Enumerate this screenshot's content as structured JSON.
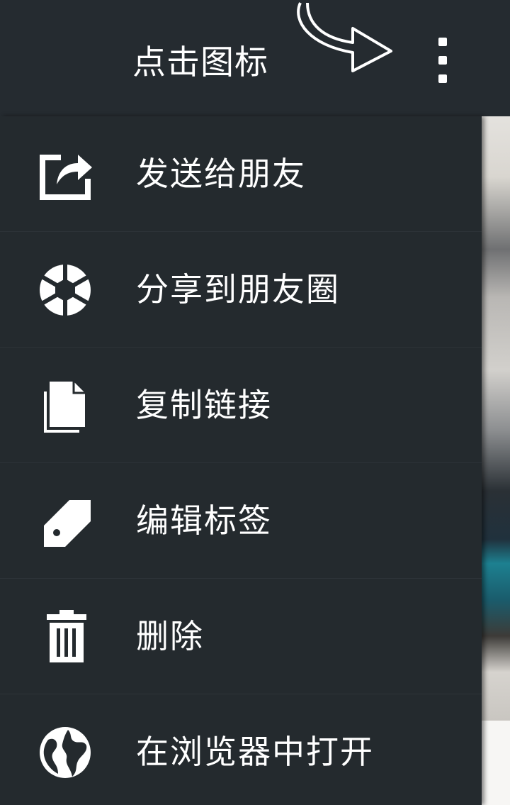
{
  "header": {
    "hint_text": "点击图标",
    "arrow_icon": "curved-arrow-icon",
    "overflow_icon": "more-vert-icon"
  },
  "menu": {
    "items": [
      {
        "label": "发送给朋友",
        "icon": "share-icon"
      },
      {
        "label": "分享到朋友圈",
        "icon": "aperture-icon"
      },
      {
        "label": "复制链接",
        "icon": "copy-icon"
      },
      {
        "label": "编辑标签",
        "icon": "tag-icon"
      },
      {
        "label": "删除",
        "icon": "trash-icon"
      },
      {
        "label": "在浏览器中打开",
        "icon": "globe-icon"
      }
    ]
  },
  "colors": {
    "background": "#24292d",
    "text": "#ffffff"
  }
}
